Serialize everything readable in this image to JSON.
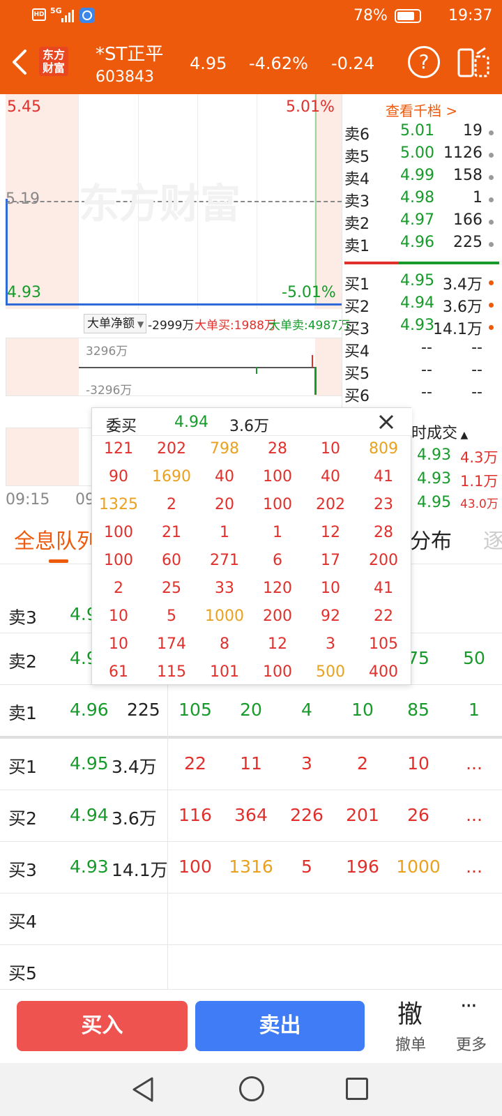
{
  "status_bar": {
    "battery": "78%",
    "time": "19:37",
    "network": "5G"
  },
  "header": {
    "logo_text_1": "东方",
    "logo_text_2": "财富",
    "stock_name": "*ST正平",
    "stock_code": "603843",
    "price": "4.95",
    "change_pct": "-4.62%",
    "change": "-0.24"
  },
  "chart": {
    "y_top": "5.45",
    "y_mid": "5.19",
    "y_bottom": "4.93",
    "pct_top": "5.01%",
    "pct_bottom": "-5.01%",
    "watermark": "东方财富",
    "time_start": "09:15",
    "time_next": "09",
    "indicator": {
      "selector": "大单净额",
      "net": "-2999万",
      "buy": "大单买:1988万",
      "sell": "大单卖:4987万",
      "top": "3296万",
      "bottom": "-3296万"
    }
  },
  "order_book": {
    "link": "查看千档 >",
    "asks": [
      {
        "label": "卖6",
        "price": "5.01",
        "vol": "19"
      },
      {
        "label": "卖5",
        "price": "5.00",
        "vol": "1126"
      },
      {
        "label": "卖4",
        "price": "4.99",
        "vol": "158"
      },
      {
        "label": "卖3",
        "price": "4.98",
        "vol": "1"
      },
      {
        "label": "卖2",
        "price": "4.97",
        "vol": "166"
      },
      {
        "label": "卖1",
        "price": "4.96",
        "vol": "225"
      }
    ],
    "bids": [
      {
        "label": "买1",
        "price": "4.95",
        "vol": "3.4万"
      },
      {
        "label": "买2",
        "price": "4.94",
        "vol": "3.6万"
      },
      {
        "label": "买3",
        "price": "4.93",
        "vol": "14.1万"
      },
      {
        "label": "买4",
        "price": "--",
        "vol": "--"
      },
      {
        "label": "买5",
        "price": "--",
        "vol": "--"
      },
      {
        "label": "买6",
        "price": "--",
        "vol": "--"
      }
    ]
  },
  "ticks": {
    "title": "时成交",
    "rows": [
      {
        "price": "4.93",
        "vol": "4.3万"
      },
      {
        "price": "4.93",
        "vol": "1.1万"
      },
      {
        "price": "4.95",
        "vol": "43.0万"
      }
    ]
  },
  "tabs": {
    "active": "全息队列",
    "other": "分布",
    "faded": "逐"
  },
  "queue_table": {
    "ask_rows": [
      {
        "label": "卖3",
        "price": "4.9"
      },
      {
        "label": "卖2",
        "price": "4.9",
        "partial": [
          "75",
          "50"
        ]
      },
      {
        "label": "卖1",
        "price": "4.96",
        "vol": "225",
        "orders": [
          "105",
          "20",
          "4",
          "10",
          "85",
          "1"
        ]
      }
    ],
    "bid_rows": [
      {
        "label": "买1",
        "price": "4.95",
        "vol": "3.4万",
        "orders": [
          "22",
          "11",
          "3",
          "2",
          "10"
        ],
        "more": "..."
      },
      {
        "label": "买2",
        "price": "4.94",
        "vol": "3.6万",
        "orders": [
          "116",
          "364",
          "226",
          "201",
          "26"
        ],
        "more": "..."
      },
      {
        "label": "买3",
        "price": "4.93",
        "vol": "14.1万",
        "orders": [
          "100",
          "1316",
          "5",
          "196",
          "1000"
        ],
        "more": "..."
      },
      {
        "label": "买4"
      },
      {
        "label": "买5"
      }
    ]
  },
  "popup": {
    "title": "委买",
    "price": "4.94",
    "vol": "3.6万",
    "cells": [
      [
        "121",
        "202",
        "798",
        "28",
        "10",
        "809"
      ],
      [
        "90",
        "1690",
        "40",
        "100",
        "40",
        "41"
      ],
      [
        "1325",
        "2",
        "20",
        "100",
        "202",
        "23"
      ],
      [
        "100",
        "21",
        "1",
        "1",
        "12",
        "28"
      ],
      [
        "100",
        "60",
        "271",
        "6",
        "17",
        "200"
      ],
      [
        "2",
        "25",
        "33",
        "120",
        "10",
        "41"
      ],
      [
        "10",
        "5",
        "1000",
        "200",
        "92",
        "22"
      ],
      [
        "10",
        "174",
        "8",
        "12",
        "3",
        "105"
      ],
      [
        "61",
        "115",
        "101",
        "100",
        "500",
        "400"
      ]
    ],
    "highlight": [
      "798",
      "809",
      "1690",
      "1325",
      "1000",
      "500"
    ]
  },
  "actions": {
    "buy": "买入",
    "sell": "卖出",
    "cancel_icon": "撤",
    "cancel": "撤单",
    "more_icon": "···",
    "more": "更多"
  },
  "colors": {
    "brand": "#ee5a0c",
    "up": "#e0302c",
    "down": "#169b2a",
    "highlight": "#e9a11f",
    "buy_btn": "#ef5350",
    "sell_btn": "#3f7cf5"
  }
}
